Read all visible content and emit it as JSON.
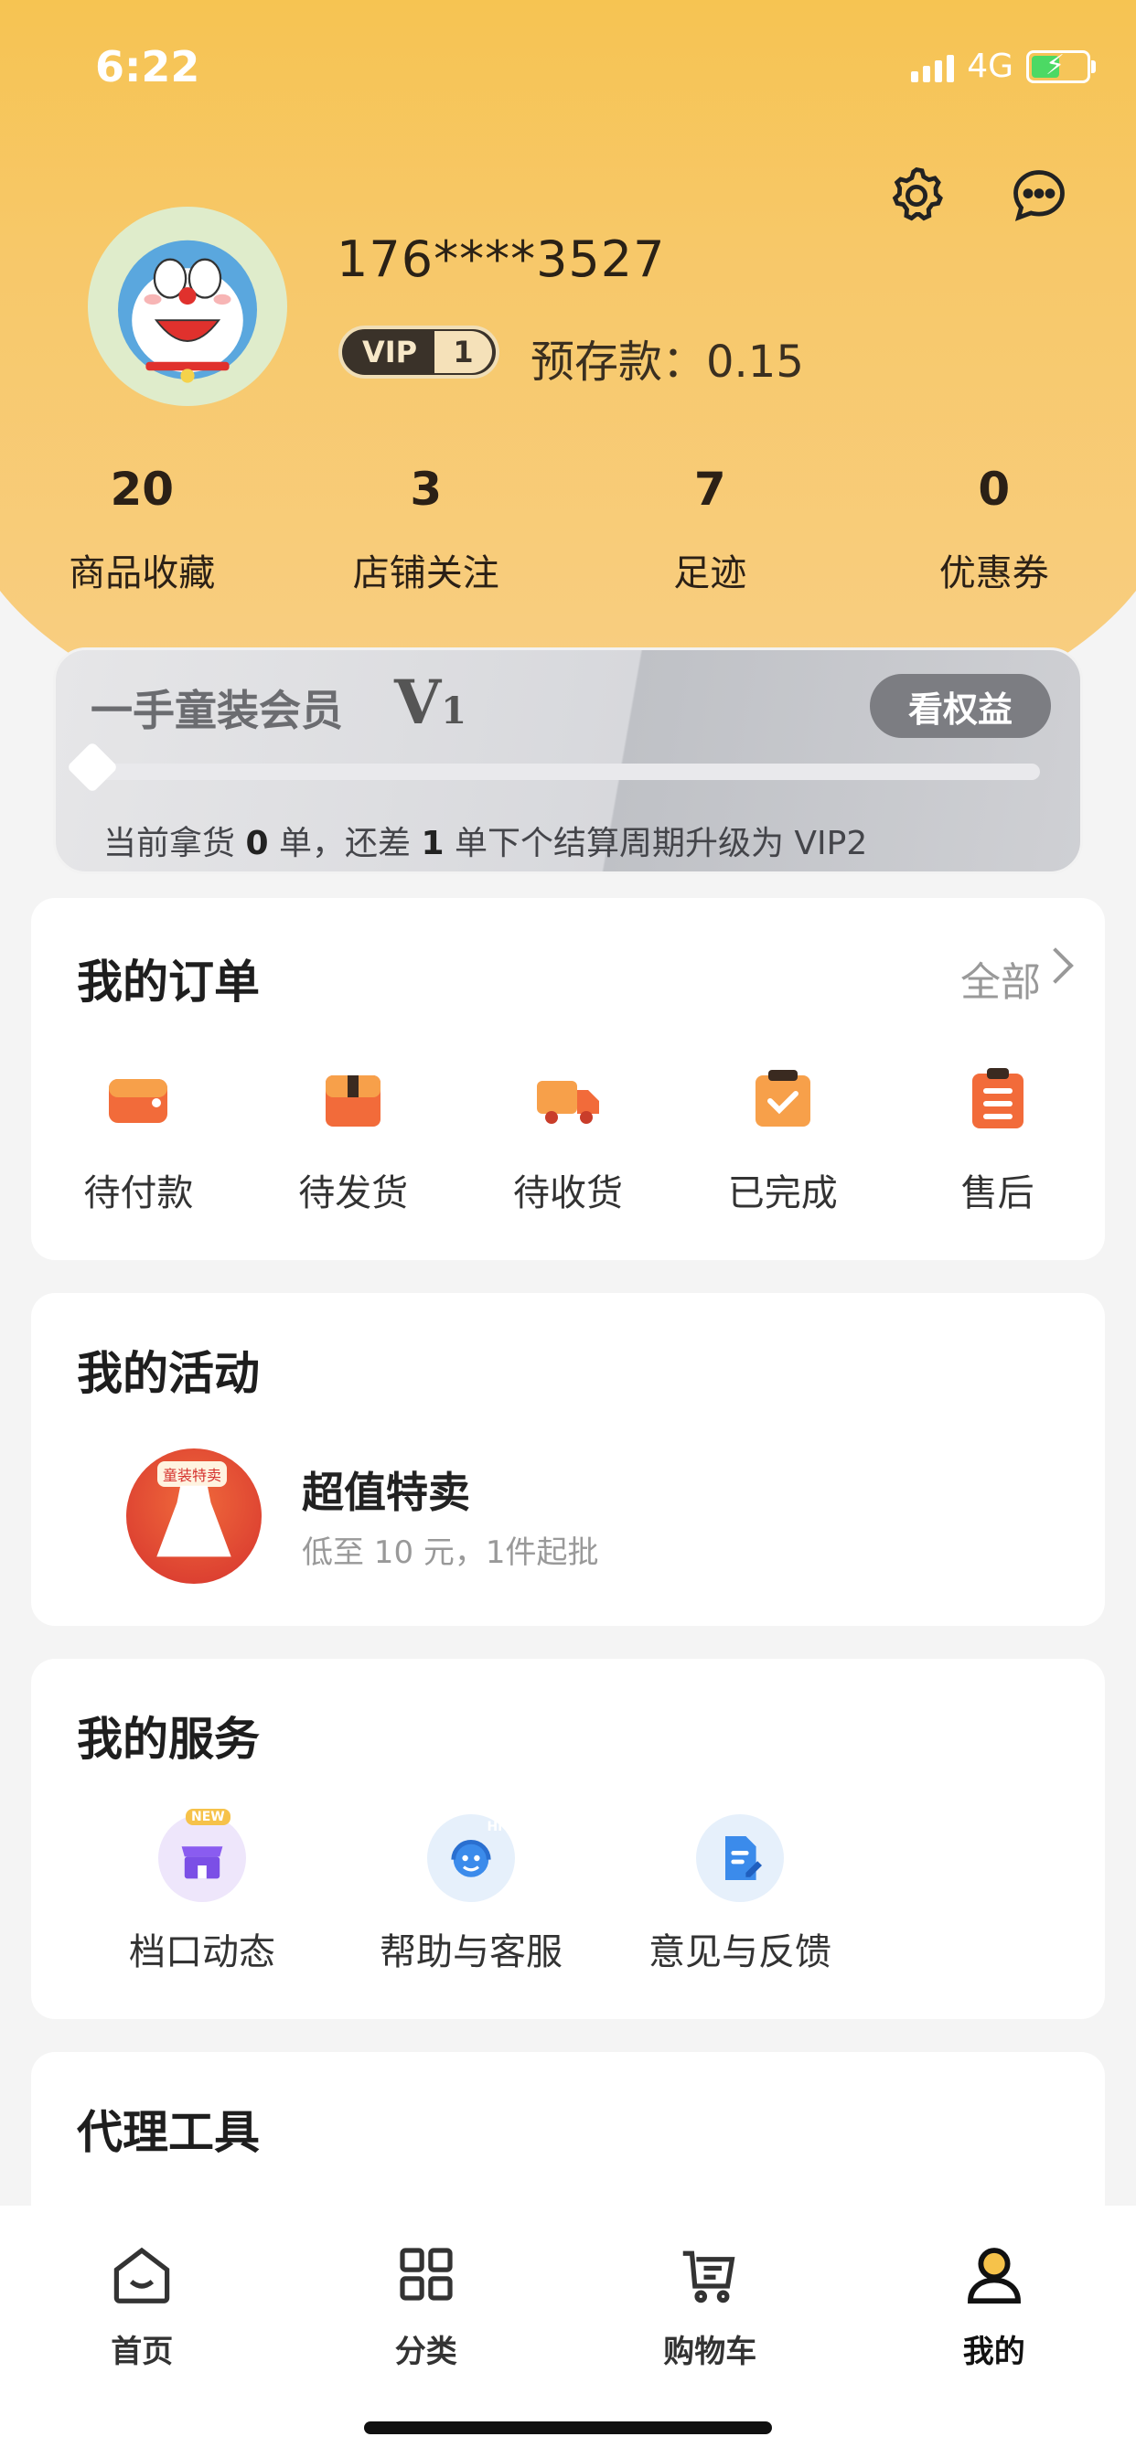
{
  "status": {
    "time": "6:22",
    "network": "4G"
  },
  "profile": {
    "phone": "176****3527",
    "vip_text": "VIP",
    "vip_level": "1",
    "deposit": "预存款：0.15"
  },
  "stats": [
    {
      "num": "20",
      "label": "商品收藏"
    },
    {
      "num": "3",
      "label": "店铺关注"
    },
    {
      "num": "7",
      "label": "足迹"
    },
    {
      "num": "0",
      "label": "优惠券"
    }
  ],
  "membership": {
    "title": "一手童装会员",
    "level_letter": "V",
    "level_num": "1",
    "benefit_button": "看权益",
    "desc_a": "当前拿货",
    "desc_b": "0",
    "desc_c": "单，还差",
    "desc_d": "1",
    "desc_e": "单下个结算周期升级为 VIP2",
    "progress": 0
  },
  "orders": {
    "title": "我的订单",
    "all_label": "全部",
    "items": [
      {
        "label": "待付款",
        "icon": "wallet-icon"
      },
      {
        "label": "待发货",
        "icon": "box-icon"
      },
      {
        "label": "待收货",
        "icon": "truck-icon"
      },
      {
        "label": "已完成",
        "icon": "check-clipboard-icon"
      },
      {
        "label": "售后",
        "icon": "list-clipboard-icon"
      }
    ]
  },
  "activities": {
    "title": "我的活动",
    "item_badge": "童装特卖",
    "item_title": "超值特卖",
    "item_sub": "低至 10 元，1件起批"
  },
  "services": {
    "title": "我的服务",
    "items": [
      {
        "label": "档口动态",
        "icon": "store-icon",
        "badge": "NEW"
      },
      {
        "label": "帮助与客服",
        "icon": "support-icon",
        "badge": "Hi"
      },
      {
        "label": "意见与反馈",
        "icon": "feedback-doc-icon"
      }
    ]
  },
  "agent_tools": {
    "title": "代理工具"
  },
  "tabbar": [
    {
      "label": "首页",
      "icon": "home-icon"
    },
    {
      "label": "分类",
      "icon": "grid-icon"
    },
    {
      "label": "购物车",
      "icon": "cart-icon"
    },
    {
      "label": "我的",
      "icon": "user-icon",
      "active": true
    }
  ],
  "colors": {
    "header_yellow": "#f6c24a",
    "order_orange": "#f26b3a",
    "active_tab": "#111111"
  }
}
